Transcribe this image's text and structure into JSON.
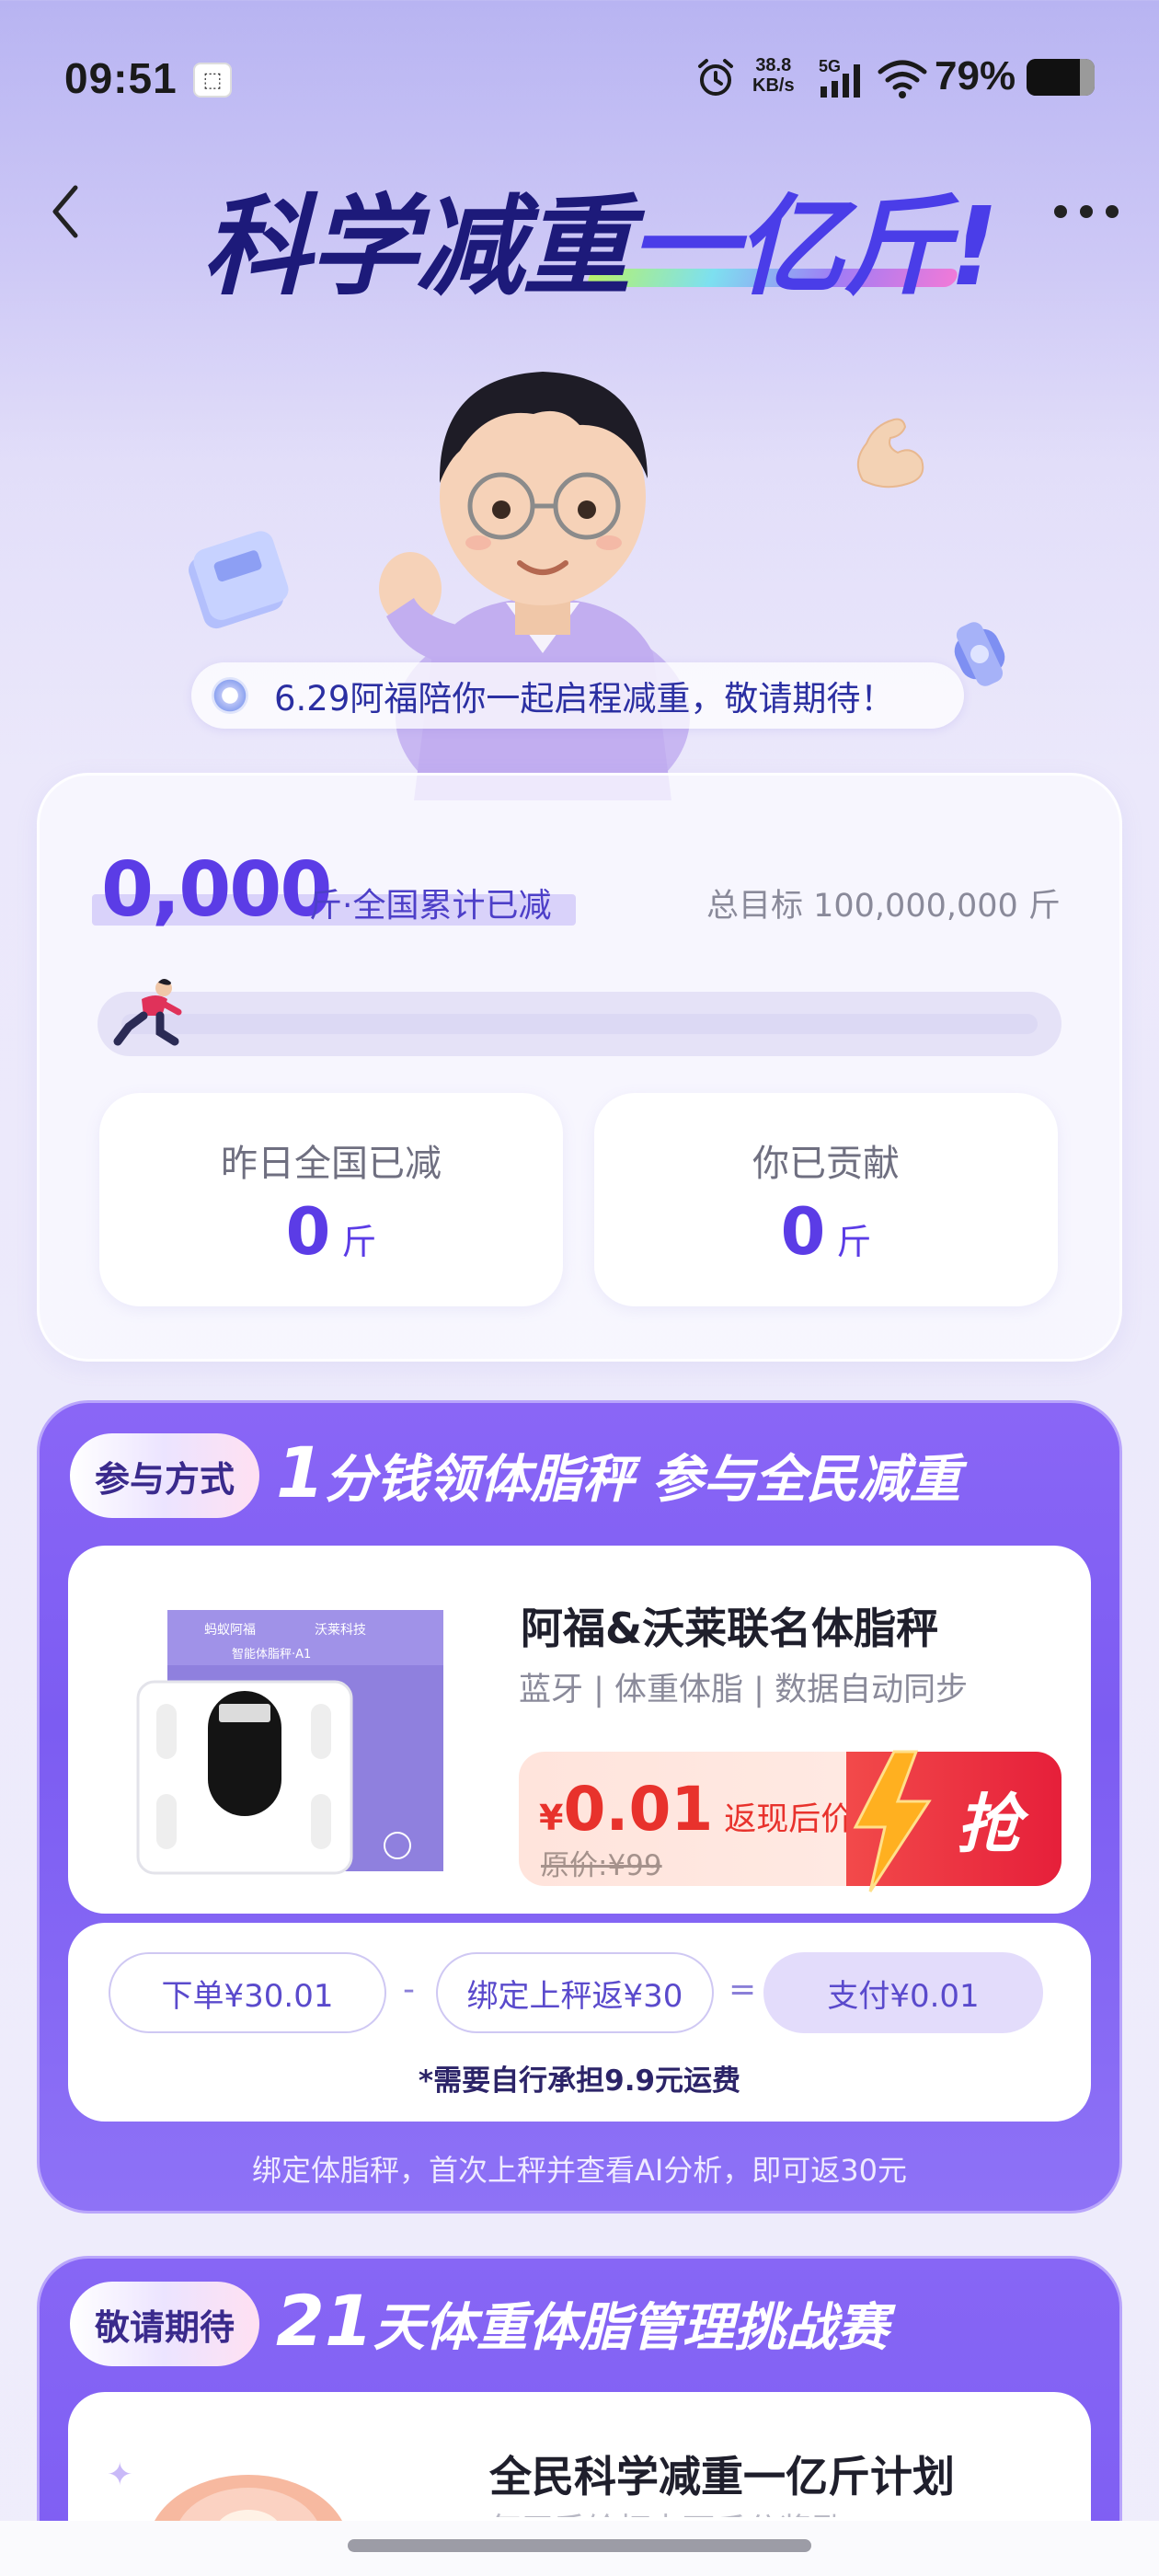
{
  "status_bar": {
    "time": "09:51",
    "net_speed_value": "38.8",
    "net_speed_unit": "KB/s",
    "network_type": "5G",
    "battery_percent": "79%",
    "battery_level": 0.79
  },
  "header": {
    "title_part1": "科学减重",
    "title_part2": "一亿斤!",
    "accent_color": "#4a3de8"
  },
  "announcement": {
    "text": "6.29阿福陪你一起启程减重，敬请期待！"
  },
  "stats": {
    "total_reduced": "0,000",
    "total_label": "斤·全国累计已减",
    "goal_label": "总目标 100,000,000 斤",
    "progress_fraction": 0.0,
    "yesterday_title": "昨日全国已减",
    "yesterday_value": "0",
    "yesterday_unit": "斤",
    "contributed_title": "你已贡献",
    "contributed_value": "0",
    "contributed_unit": "斤"
  },
  "participate": {
    "tag": "参与方式",
    "title_big": "1",
    "title_rest": "分钱领体脂秤 参与全民减重",
    "product_name": "阿福&沃莱联名体脂秤",
    "product_tags": "蓝牙 | 体重体脂 | 数据自动同步",
    "price_yen": "¥",
    "price_value": "0.01",
    "price_label": "返现后价",
    "original_price": "原价:¥99",
    "grab_label": "抢",
    "box_brand_left": "蚂蚁阿福",
    "box_brand_right": "沃莱科技",
    "box_model": "智能体脂秤·A1",
    "formula_order": "下单¥30.01",
    "formula_minus": "-",
    "formula_bind": "绑定上秤返¥30",
    "formula_equals": "=",
    "formula_pay": "支付¥0.01",
    "shipping_note": "*需要自行承担9.9元运费",
    "cashback_note": "绑定体脂秤，首次上秤并查看AI分析，即可返30元"
  },
  "challenge": {
    "tag": "敬请期待",
    "title_big": "21",
    "title_rest": "天体重体脂管理挑战赛",
    "plan_title": "全民科学减重一亿斤计划",
    "plan_sub": "每天手绘打卡可瓜分奖励"
  }
}
